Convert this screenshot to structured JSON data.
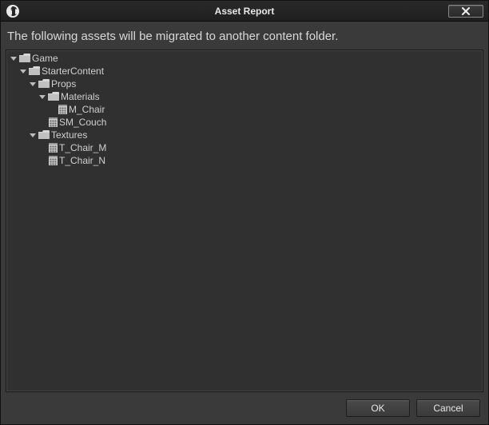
{
  "window": {
    "title": "Asset Report",
    "message": "The following assets will be migrated to another content folder."
  },
  "tree": {
    "root": {
      "label": "Game",
      "children": {
        "starter": {
          "label": "StarterContent",
          "children": {
            "props": {
              "label": "Props",
              "children": {
                "materials": {
                  "label": "Materials",
                  "assets": {
                    "m_chair": {
                      "label": "M_Chair"
                    }
                  }
                },
                "sm_couch": {
                  "label": "SM_Couch"
                }
              }
            },
            "textures": {
              "label": "Textures",
              "assets": {
                "t_chair_m": {
                  "label": "T_Chair_M"
                },
                "t_chair_n": {
                  "label": "T_Chair_N"
                }
              }
            }
          }
        }
      }
    }
  },
  "buttons": {
    "ok": "OK",
    "cancel": "Cancel"
  },
  "icons": {
    "logo": "unreal-logo",
    "close": "close-x",
    "expander": "triangle-down",
    "folder": "folder",
    "asset": "grid-asset"
  }
}
